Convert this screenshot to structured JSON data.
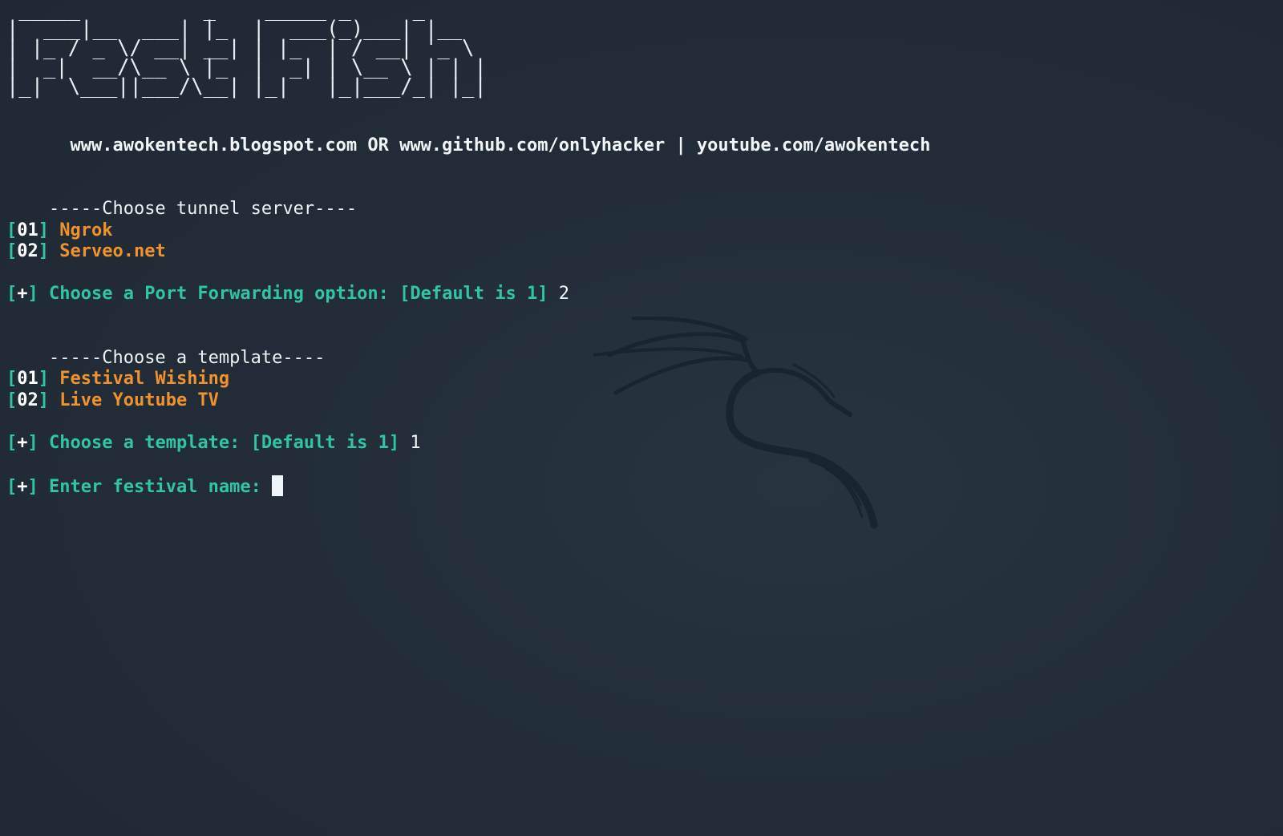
{
  "banner": {
    "ascii_lines": [
      " _____          _    _____ _     _    ",
      "|  ___|__  ___| |_  |  ___(_)___| |__ ",
      "| |_ / _ \\/ __| __| | |_  | / __| '_ \\",
      "|  _|  __/\\__ \\ |_  |  _| | \\__ \\ | | |",
      "|_|  \\___||___/\\__| |_|   |_|___/_| |_|"
    ],
    "credits": "  www.awokentech.blogspot.com OR www.github.com/onlyhacker | youtube.com/awokentech"
  },
  "tunnel_section": {
    "header": "-----Choose tunnel server----",
    "options": [
      {
        "num": "01",
        "label": "Ngrok"
      },
      {
        "num": "02",
        "label": "Serveo.net"
      }
    ],
    "prompt": "Choose a Port Forwarding option: [Default is 1]",
    "answer": "2"
  },
  "template_section": {
    "header": "-----Choose a template----",
    "options": [
      {
        "num": "01",
        "label": "Festival Wishing"
      },
      {
        "num": "02",
        "label": "Live Youtube TV"
      }
    ],
    "prompt": "Choose a template: [Default is 1]",
    "answer": "1"
  },
  "festival_prompt": {
    "prompt": "Enter festival name:",
    "value": ""
  },
  "symbols": {
    "plus": "+",
    "open_bracket": "[",
    "close_bracket": "]"
  },
  "colors": {
    "background": "#222d38",
    "accent_teal": "#31c4a6",
    "option_orange": "#f0922e",
    "text": "#e6edf0"
  },
  "icons": {
    "background_logo": "kali-dragon-icon",
    "cursor": "block-cursor-icon"
  }
}
